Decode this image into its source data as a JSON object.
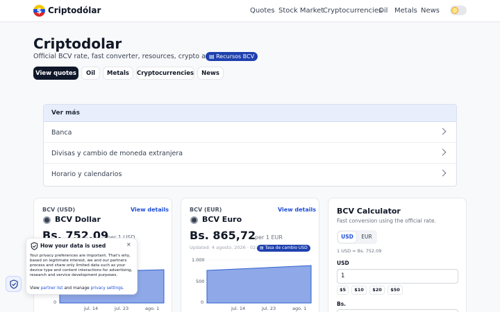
{
  "header": {
    "brand": "Criptodólar",
    "logo_symbol": "$",
    "nav": [
      "Quotes",
      "Stock Market",
      "Cryptocurrencies",
      "Oil",
      "Metals",
      "News"
    ]
  },
  "hero": {
    "title": "Criptodolar",
    "subtitle": "Official BCV rate, fast converter, resources, crypto and news.",
    "badge": "▤ Recursos BCV",
    "pills": [
      "View quotes",
      "Oil",
      "Metals",
      "Cryptocurrencies",
      "News"
    ]
  },
  "accordion": {
    "header": "Ver más",
    "items": [
      "Banca",
      "Divisas y cambio de moneda extranjera",
      "Horario y calendarios"
    ]
  },
  "cards": [
    {
      "label": "BCV (USD)",
      "link": "View details",
      "title": "BCV Dollar",
      "price": "Bs. 752,09",
      "unit": "per 1 USD",
      "chart": {
        "y_ticks": [
          "0"
        ],
        "x_ticks": [
          "jul. 14",
          "jul. 23",
          "ago. 1"
        ]
      }
    },
    {
      "label": "BCV (EUR)",
      "link": "View details",
      "title": "BCV Euro",
      "price": "Bs. 865,72",
      "unit": "per 1 EUR",
      "updated": "Updated: 4 agosto, 2026 · 02:15",
      "tag": "▤ Tasa de cambio USD",
      "chart": {
        "y_ticks": [
          "1.000",
          "500",
          "0"
        ],
        "x_ticks": [
          "jul. 14",
          "jul. 23",
          "ago. 1"
        ]
      }
    }
  ],
  "calculator": {
    "title": "BCV Calculator",
    "subtitle": "Fast conversion using the official rate.",
    "tabs": [
      "USD",
      "EUR"
    ],
    "rate": "1 USD = Bs. 752.09",
    "usd_label": "USD",
    "usd_value": "1",
    "chips": [
      "$5",
      "$10",
      "$20",
      "$50"
    ],
    "bs_label": "Bs."
  },
  "cookie": {
    "title": "How your data is used",
    "close": "×",
    "body": "Your privacy preferences are important. That's why, based on legitimate interest, we and our partners process and share only limited data such as your device type and content interactions for advertising, research and service development purposes.",
    "foot_prefix": "View",
    "partner_link": "partner list",
    "foot_mid": "and manage",
    "privacy_link": "privacy settings",
    "foot_end": "."
  },
  "colors": {
    "accent": "#1d4ed8",
    "dark": "#0f172a",
    "chart_fill": "#8ea8e8",
    "chart_line": "#2f5fd0"
  }
}
